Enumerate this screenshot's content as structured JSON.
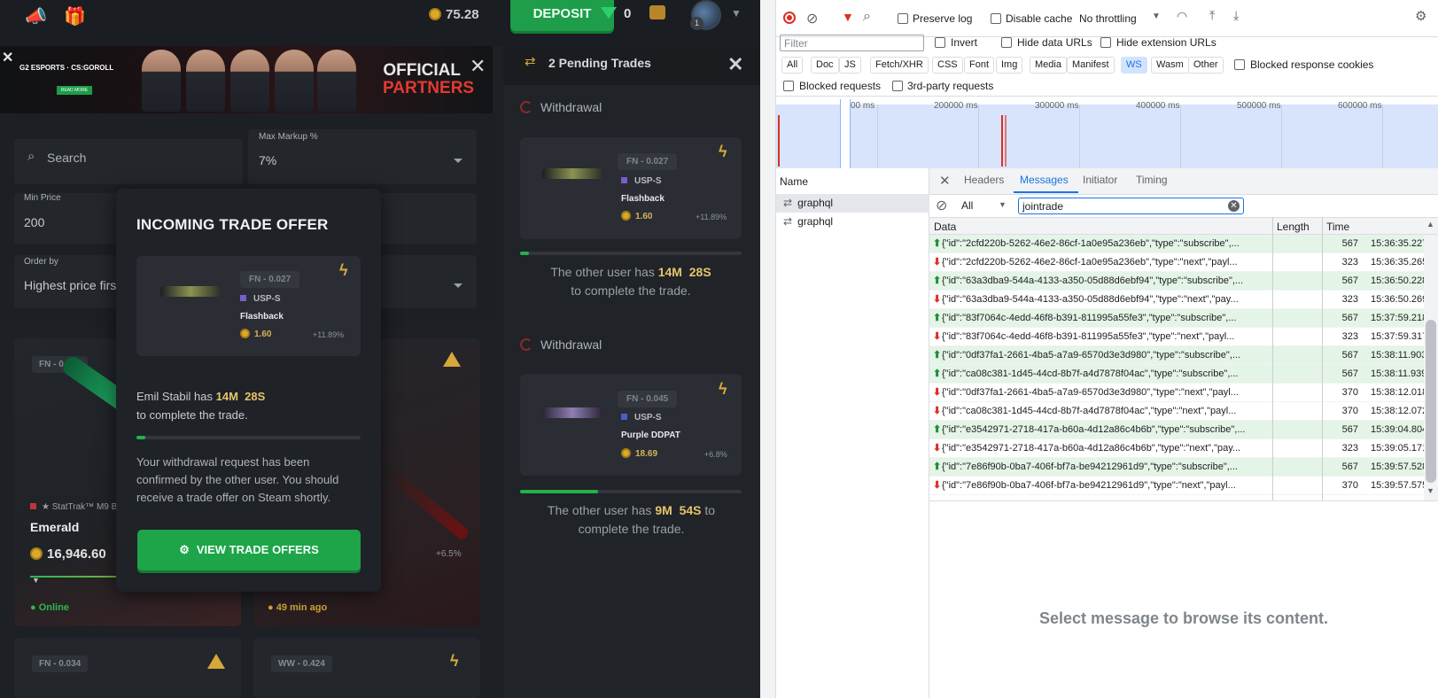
{
  "game": {
    "balance": "75.28",
    "deposit_label": "DEPOSIT",
    "gems": "0",
    "avatar_level": "1",
    "banner": {
      "logos": "G2 ESPORTS · CS:GOROLL",
      "button": "READ MORE",
      "official_line1": "OFFICIAL",
      "official_line2": "PARTNERS"
    },
    "filters": {
      "search_placeholder": "Search",
      "max_markup_label": "Max Markup %",
      "max_markup_value": "7%",
      "min_price_label": "Min Price",
      "min_price_value": "200",
      "order_by_label": "Order by",
      "order_by_value": "Highest price first"
    },
    "cards": [
      {
        "wear": "FN - 0.034",
        "stattrak": "★ StatTrak™ M9 B",
        "name": "Emerald",
        "price": "16,946.60",
        "status": "Online"
      },
      {
        "pct": "+6.5%",
        "status": "49 min ago"
      },
      {
        "wear": "FN - 0.034"
      },
      {
        "wear": "WW - 0.424"
      }
    ],
    "pending": {
      "title": "2 Pending Trades",
      "trades": [
        {
          "type_label": "Withdrawal",
          "wear": "FN - 0.027",
          "weapon": "USP-S",
          "skin": "Flashback",
          "price": "1.60",
          "pct": "+11.89%",
          "text_pre": "The other user has",
          "time_m": "14M",
          "time_s": "28S",
          "text_post": "to complete the trade.",
          "progress": 0.04
        },
        {
          "type_label": "Withdrawal",
          "wear": "FN - 0.045",
          "weapon": "USP-S",
          "skin": "Purple DDPAT",
          "price": "18.69",
          "pct": "+6.8%",
          "text_pre": "The other user has",
          "time_m": "9M",
          "time_s": "54S",
          "text_post": "to complete the trade.",
          "progress": 0.35
        }
      ]
    },
    "modal": {
      "title": "INCOMING TRADE OFFER",
      "wear": "FN - 0.027",
      "weapon": "USP-S",
      "skin": "Flashback",
      "price": "1.60",
      "pct": "+11.89%",
      "msg_name": "Emil Stabil has",
      "time_m": "14M",
      "time_s": "28S",
      "msg_post": "to complete the trade.",
      "progress": 0.04,
      "desc": "Your withdrawal request has been confirmed by the other user. You should receive a trade offer on Steam shortly.",
      "button": "VIEW TRADE OFFERS"
    }
  },
  "devtools": {
    "preserve_log": "Preserve log",
    "disable_cache": "Disable cache",
    "throttling": "No throttling",
    "filter_placeholder": "Filter",
    "invert": "Invert",
    "hide_data_urls": "Hide data URLs",
    "hide_extension_urls": "Hide extension URLs",
    "chips": [
      "All",
      "Doc",
      "JS",
      "Fetch/XHR",
      "CSS",
      "Font",
      "Img",
      "Media",
      "Manifest",
      "WS",
      "Wasm",
      "Other"
    ],
    "selected_chip": "WS",
    "blocked_response_cookies": "Blocked response cookies",
    "blocked_requests": "Blocked requests",
    "third_party": "3rd-party requests",
    "ticks": [
      "00 ms",
      "200000 ms",
      "300000 ms",
      "400000 ms",
      "500000 ms",
      "600000 ms"
    ],
    "names_header": "Name",
    "names": [
      "graphql",
      "graphql"
    ],
    "tabs": [
      "Headers",
      "Messages",
      "Initiator",
      "Timing"
    ],
    "active_tab": "Messages",
    "msg_filter_type": "All",
    "msg_filter_value": "jointrade",
    "columns": [
      "Data",
      "Length",
      "Time"
    ],
    "messages": [
      {
        "dir": "sent",
        "data": "{\"id\":\"2cfd220b-5262-46e2-86cf-1a0e95a236eb\",\"type\":\"subscribe\",...",
        "length": "567",
        "time": "15:36:35.227"
      },
      {
        "dir": "recv",
        "data": "{\"id\":\"2cfd220b-5262-46e2-86cf-1a0e95a236eb\",\"type\":\"next\",\"payl...",
        "length": "323",
        "time": "15:36:35.265"
      },
      {
        "dir": "sent",
        "data": "{\"id\":\"63a3dba9-544a-4133-a350-05d88d6ebf94\",\"type\":\"subscribe\",...",
        "length": "567",
        "time": "15:36:50.228"
      },
      {
        "dir": "recv",
        "data": "{\"id\":\"63a3dba9-544a-4133-a350-05d88d6ebf94\",\"type\":\"next\",\"pay...",
        "length": "323",
        "time": "15:36:50.269"
      },
      {
        "dir": "sent",
        "data": "{\"id\":\"83f7064c-4edd-46f8-b391-811995a55fe3\",\"type\":\"subscribe\",...",
        "length": "567",
        "time": "15:37:59.218"
      },
      {
        "dir": "recv",
        "data": "{\"id\":\"83f7064c-4edd-46f8-b391-811995a55fe3\",\"type\":\"next\",\"payl...",
        "length": "323",
        "time": "15:37:59.317"
      },
      {
        "dir": "sent",
        "data": "{\"id\":\"0df37fa1-2661-4ba5-a7a9-6570d3e3d980\",\"type\":\"subscribe\",...",
        "length": "567",
        "time": "15:38:11.903"
      },
      {
        "dir": "sent",
        "data": "{\"id\":\"ca08c381-1d45-44cd-8b7f-a4d7878f04ac\",\"type\":\"subscribe\",...",
        "length": "567",
        "time": "15:38:11.939"
      },
      {
        "dir": "recv",
        "data": "{\"id\":\"0df37fa1-2661-4ba5-a7a9-6570d3e3d980\",\"type\":\"next\",\"payl...",
        "length": "370",
        "time": "15:38:12.018"
      },
      {
        "dir": "recv",
        "data": "{\"id\":\"ca08c381-1d45-44cd-8b7f-a4d7878f04ac\",\"type\":\"next\",\"payl...",
        "length": "370",
        "time": "15:38:12.072"
      },
      {
        "dir": "sent",
        "data": "{\"id\":\"e3542971-2718-417a-b60a-4d12a86c4b6b\",\"type\":\"subscribe\",...",
        "length": "567",
        "time": "15:39:04.804"
      },
      {
        "dir": "recv",
        "data": "{\"id\":\"e3542971-2718-417a-b60a-4d12a86c4b6b\",\"type\":\"next\",\"pay...",
        "length": "323",
        "time": "15:39:05.171"
      },
      {
        "dir": "sent",
        "data": "{\"id\":\"7e86f90b-0ba7-406f-bf7a-be94212961d9\",\"type\":\"subscribe\",...",
        "length": "567",
        "time": "15:39:57.528"
      },
      {
        "dir": "recv",
        "data": "{\"id\":\"7e86f90b-0ba7-406f-bf7a-be94212961d9\",\"type\":\"next\",\"payl...",
        "length": "370",
        "time": "15:39:57.575"
      }
    ],
    "empty_message": "Select message to browse its content."
  }
}
